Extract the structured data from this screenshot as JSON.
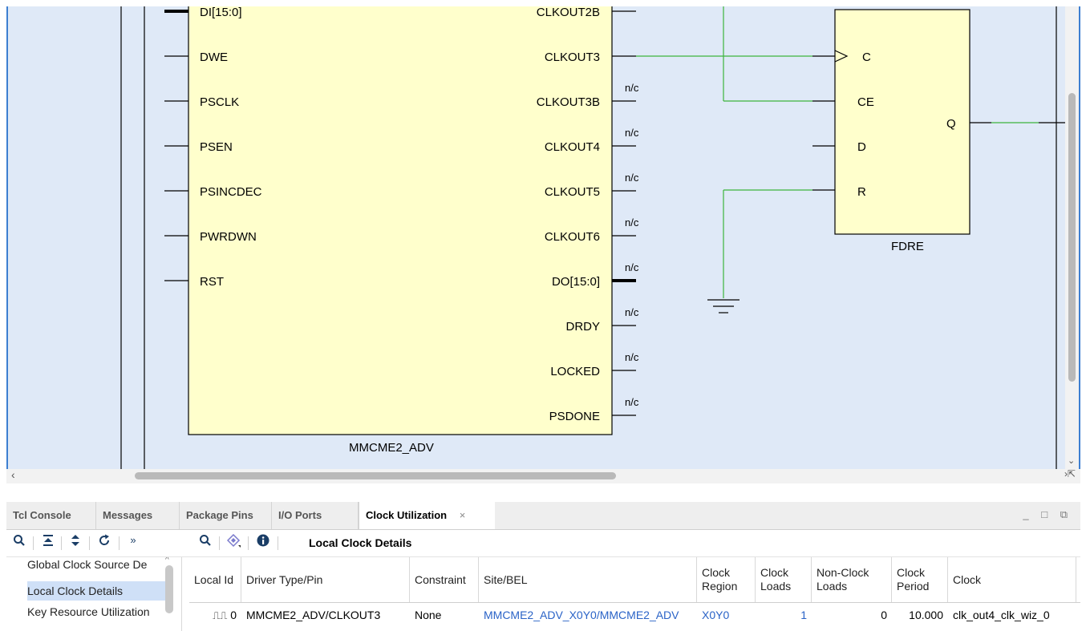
{
  "schematic": {
    "mmcm": {
      "name": "MMCME2_ADV",
      "left_pins": [
        "DI[15:0]",
        "DWE",
        "PSCLK",
        "PSEN",
        "PSINCDEC",
        "PWRDWN",
        "RST"
      ],
      "right_pins": [
        "CLKOUT2B",
        "CLKOUT3",
        "CLKOUT3B",
        "CLKOUT4",
        "CLKOUT5",
        "CLKOUT6",
        "DO[15:0]",
        "DRDY",
        "LOCKED",
        "PSDONE"
      ],
      "nc_label": "n/c"
    },
    "fdre": {
      "name": "FDRE",
      "input_pins": [
        "C",
        "CE",
        "D",
        "R"
      ],
      "output_pin": "Q"
    },
    "colors": {
      "background": "#dfe9f7",
      "cell_fill": "#ffffcc",
      "net": "#3cb43c",
      "frame": "#3d7fd1"
    }
  },
  "tabs": [
    {
      "label": "Tcl Console"
    },
    {
      "label": "Messages"
    },
    {
      "label": "Package Pins"
    },
    {
      "label": "I/O Ports"
    },
    {
      "label": "Clock Utilization",
      "active": true
    }
  ],
  "tab_close": "×",
  "window_controls": "_ □ ⧉",
  "toolbar": {
    "title": "Local Clock Details",
    "more": "»"
  },
  "nav": {
    "items": [
      {
        "label": "Global Clock Source De"
      },
      {
        "label": "Local Clock Details",
        "selected": true
      },
      {
        "label": "Key Resource Utilization"
      }
    ]
  },
  "table": {
    "headers": [
      "Local Id",
      "Driver Type/Pin",
      "Constraint",
      "Site/BEL",
      "Clock Region",
      "Clock Loads",
      "Non-Clock Loads",
      "Clock Period",
      "Clock"
    ],
    "rows": [
      {
        "local_id": "0",
        "driver": "MMCME2_ADV/CLKOUT3",
        "constraint": "None",
        "site_bel": "MMCME2_ADV_X0Y0/MMCME2_ADV",
        "clock_region": "X0Y0",
        "clock_loads": "1",
        "non_clock_loads": "0",
        "clock_period": "10.000",
        "clock": "clk_out4_clk_wiz_0"
      }
    ]
  }
}
